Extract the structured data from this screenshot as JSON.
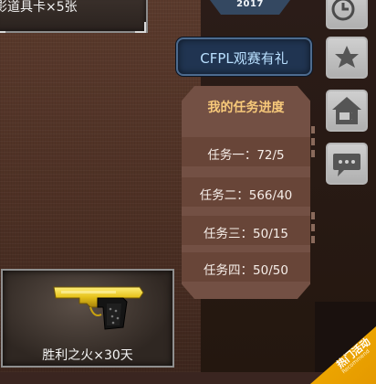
{
  "reward_top": {
    "label": "影道具卡×5张"
  },
  "badge": {
    "text": "2017"
  },
  "banner": {
    "label": "CFPL观赛有礼"
  },
  "tasks": {
    "title": "我的任务进度",
    "items": [
      {
        "label": "任务一：72/5"
      },
      {
        "label": "任务二：566/40"
      },
      {
        "label": "任务三：50/15"
      },
      {
        "label": "任务四：50/50"
      }
    ]
  },
  "side_buttons": [
    {
      "icon": "clock-icon"
    },
    {
      "icon": "star-icon"
    },
    {
      "icon": "home-share-icon"
    },
    {
      "icon": "chat-icon"
    }
  ],
  "reward_gun": {
    "label": "胜利之火×30天",
    "icon": "golden-pistol-icon"
  },
  "ribbon": {
    "label": "热门活动",
    "sub": "Recommend"
  },
  "colors": {
    "task_title": "#f7c97a",
    "banner_text": "#b9e0ff",
    "ribbon": "#f5b100"
  }
}
